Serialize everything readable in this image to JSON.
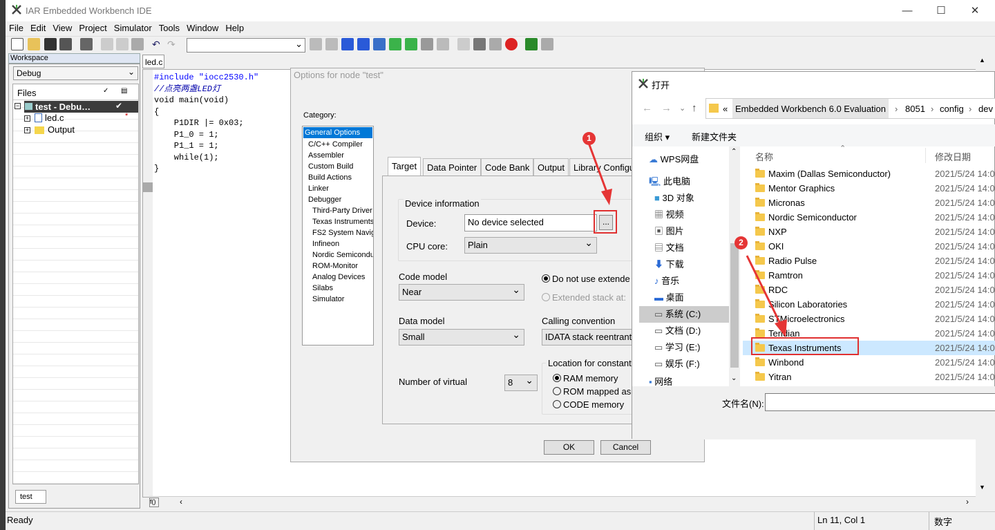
{
  "app": {
    "title": "IAR Embedded Workbench IDE",
    "minimize": "—",
    "maximize": "☐",
    "close": "✕"
  },
  "menu": [
    "File",
    "Edit",
    "View",
    "Project",
    "Simulator",
    "Tools",
    "Window",
    "Help"
  ],
  "workspace": {
    "header": "Workspace",
    "config": "Debug",
    "files_header": "Files",
    "tree": [
      "test - Debu…",
      "led.c",
      "Output"
    ],
    "tab": "test"
  },
  "editor": {
    "tab": "led.c",
    "code": [
      "#include \"iocc2530.h\"",
      "",
      "//点亮两盏LED灯",
      "void main(void)",
      "{",
      "    P1DIR |= 0x03;",
      "    P1_0 = 1;",
      "    P1_1 = 1;",
      "    while(1);",
      "}"
    ]
  },
  "status": {
    "ready": "Ready",
    "pos": "Ln 11, Col 1",
    "ime": "数字"
  },
  "options": {
    "title": "Options for node \"test\"",
    "category_label": "Category:",
    "categories": [
      "General Options",
      "C/C++ Compiler",
      "Assembler",
      "Custom Build",
      "Build Actions",
      "Linker",
      "Debugger",
      "Third-Party Driver",
      "Texas Instruments",
      "FS2 System Navig",
      "Infineon",
      "Nordic Semiconduc",
      "ROM-Monitor",
      "Analog Devices",
      "Silabs",
      "Simulator"
    ],
    "tabs": [
      "Target",
      "Data Pointer",
      "Code Bank",
      "Output",
      "Library Configu"
    ],
    "device_info": "Device information",
    "device_label": "Device:",
    "device_value": "No device selected",
    "browse": "...",
    "cpu_label": "CPU core:",
    "cpu_value": "Plain",
    "code_model_label": "Code model",
    "code_model": "Near",
    "data_model_label": "Data model",
    "data_model": "Small",
    "ext_stack_1": "Do not use extende",
    "ext_stack_2": "Extended stack at:",
    "calling_label": "Calling convention",
    "calling": "IDATA stack reentrant",
    "virtual_label": "Number of virtual",
    "virtual_value": "8",
    "location_label": "Location for constant",
    "loc1": "RAM memory",
    "loc2": "ROM mapped as",
    "loc3": "CODE memory",
    "ok": "OK",
    "cancel": "Cancel"
  },
  "open_dialog": {
    "title": "打开",
    "path": [
      "«",
      "Embedded Workbench 6.0 Evaluation",
      "›",
      "8051",
      "›",
      "config",
      "›",
      "dev"
    ],
    "organize": "组织 ▾",
    "new_folder": "新建文件夹",
    "nav": [
      "WPS网盘",
      "此电脑",
      "3D 对象",
      "视频",
      "图片",
      "文档",
      "下载",
      "音乐",
      "桌面",
      "系统 (C:)",
      "文档 (D:)",
      "学习 (E:)",
      "娱乐 (F:)",
      "网络"
    ],
    "col_name": "名称",
    "col_date": "修改日期",
    "files": [
      "Maxim (Dallas Semiconductor)",
      "Mentor Graphics",
      "Micronas",
      "Nordic Semiconductor",
      "NXP",
      "OKI",
      "Radio Pulse",
      "Ramtron",
      "RDC",
      "Silicon Laboratories",
      "STMicroelectronics",
      "Teridian",
      "Texas Instruments",
      "Winbond",
      "Yitran"
    ],
    "date": "2021/5/24 14:0",
    "filename_label": "文件名(N):"
  },
  "annotations": [
    "1",
    "2"
  ]
}
